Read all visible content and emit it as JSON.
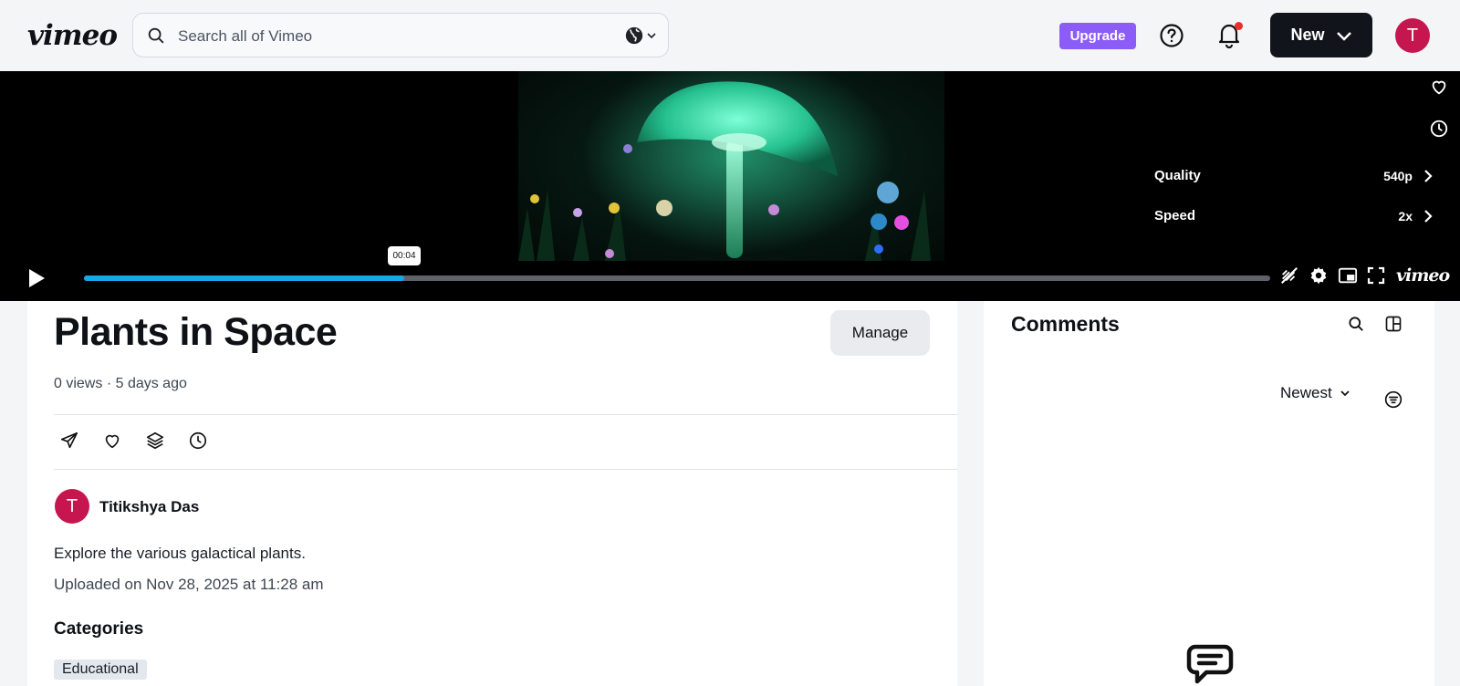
{
  "header": {
    "logo": "vimeo",
    "search_placeholder": "Search all of Vimeo",
    "upgrade_label": "Upgrade",
    "new_label": "New",
    "avatar_initial": "T"
  },
  "player": {
    "timestamp": "00:04",
    "progress": 0.27,
    "menu": [
      {
        "label": "Quality",
        "value": "540p"
      },
      {
        "label": "Speed",
        "value": "2x"
      }
    ],
    "logo": "vimeo",
    "accent": "#17a6e8"
  },
  "video": {
    "title": "Plants in Space",
    "manage_label": "Manage",
    "views": "0 views",
    "posted": "5 days ago",
    "owner_initial": "T",
    "owner_name": "Titikshya Das",
    "description": "Explore the various galactical plants.",
    "uploaded": "Uploaded on Nov 28, 2025 at 11:28 am",
    "categories_title": "Categories",
    "categories": [
      "Educational"
    ]
  },
  "comments": {
    "title": "Comments",
    "sort_label": "Newest"
  },
  "colors": {
    "brand_avatar": "#c6164f",
    "upgrade": "#8b5cf6"
  }
}
